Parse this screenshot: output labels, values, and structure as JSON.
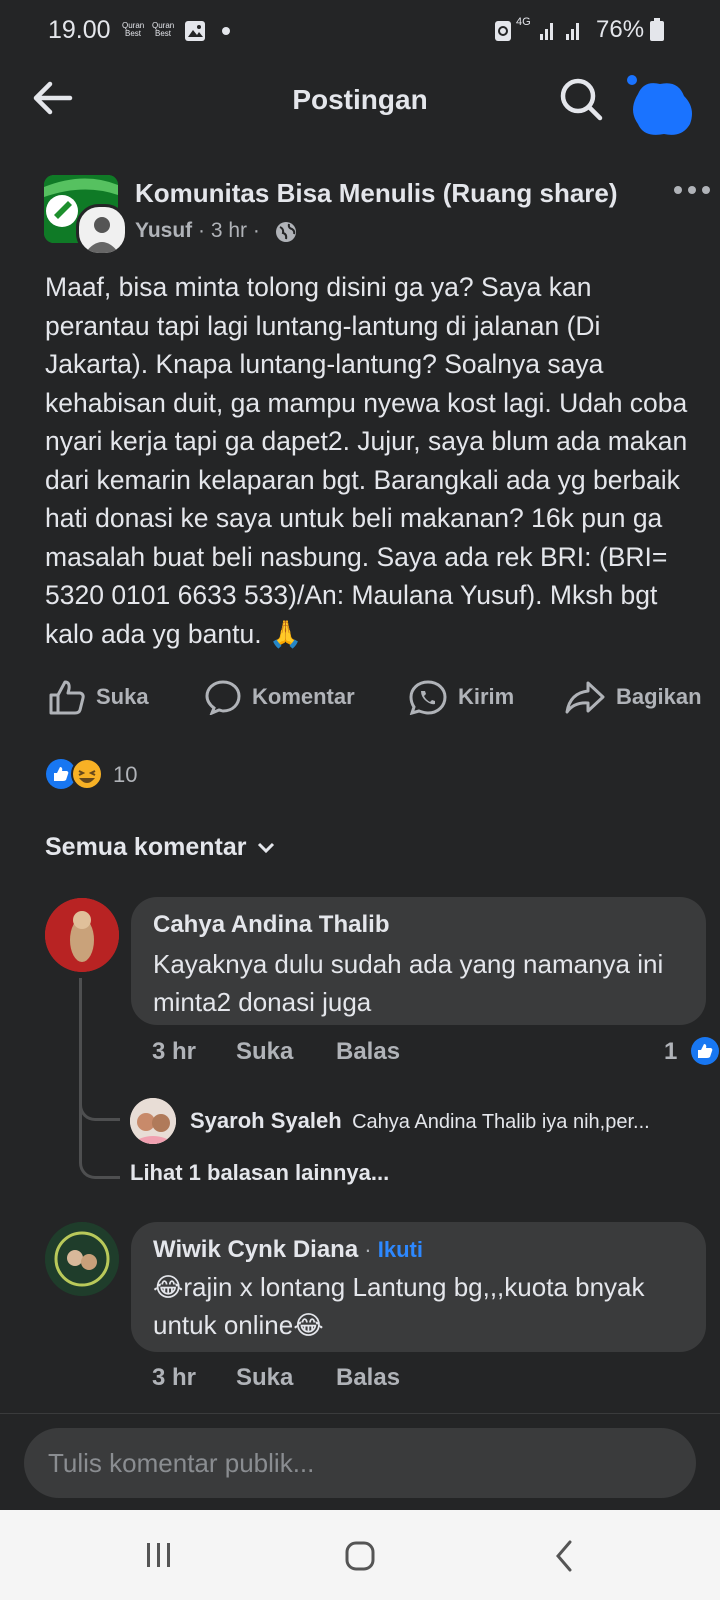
{
  "status_bar": {
    "time": "19.00",
    "app_badge_1": "Quran Best",
    "app_badge_2": "Quran Best",
    "network": "4G",
    "battery": "76%"
  },
  "header": {
    "title": "Postingan",
    "icons": [
      "back-arrow-icon",
      "search-icon",
      "avatar"
    ]
  },
  "post": {
    "group_name": "Komunitas Bisa Menulis (Ruang share)",
    "author": "Yusuf",
    "time": "3 hr",
    "body": "Maaf, bisa minta tolong disini ga ya? Saya kan perantau tapi lagi luntang-lantung di jalanan (Di Jakarta). Knapa luntang-lantung? Soalnya saya kehabisan duit, ga mampu nyewa kost lagi. Udah coba nyari kerja tapi ga dapet2. Jujur, saya blum ada makan dari kemarin kelaparan bgt. Barangkali ada yg berbaik hati donasi ke saya untuk beli makanan? 16k pun ga masalah buat beli nasbung. Saya ada rek  BRI: (BRI= 5320 0101 6633 533)/An: Maulana Yusuf). Mksh bgt kalo ada yg bantu. 🙏",
    "reaction_count": "10"
  },
  "actions": {
    "like": "Suka",
    "comment": "Komentar",
    "send": "Kirim",
    "share": "Bagikan"
  },
  "comments_sort": "Semua komentar",
  "comments": [
    {
      "name": "Cahya Andina Thalib",
      "text": "Kayaknya dulu sudah ada yang namanya ini minta2 donasi juga",
      "time": "3 hr",
      "like": "Suka",
      "reply": "Balas",
      "likes": "1",
      "reply_preview": {
        "name": "Syaroh Syaleh",
        "text": "Cahya Andina Thalib iya nih,per..."
      },
      "more_replies": "Lihat 1 balasan lainnya..."
    },
    {
      "name": "Wiwik Cynk Diana",
      "follow": "Ikuti",
      "text": "😂rajin x lontang Lantung bg,,,kuota bnyak untuk online😂",
      "time": "3 hr",
      "like": "Suka",
      "reply": "Balas"
    }
  ],
  "composer": {
    "placeholder": "Tulis komentar publik..."
  },
  "colors": {
    "background": "#242526",
    "bubble": "#3a3b3c",
    "text": "#e4e6eb",
    "muted": "#b0b3b8",
    "accent_blue": "#1877f2"
  }
}
